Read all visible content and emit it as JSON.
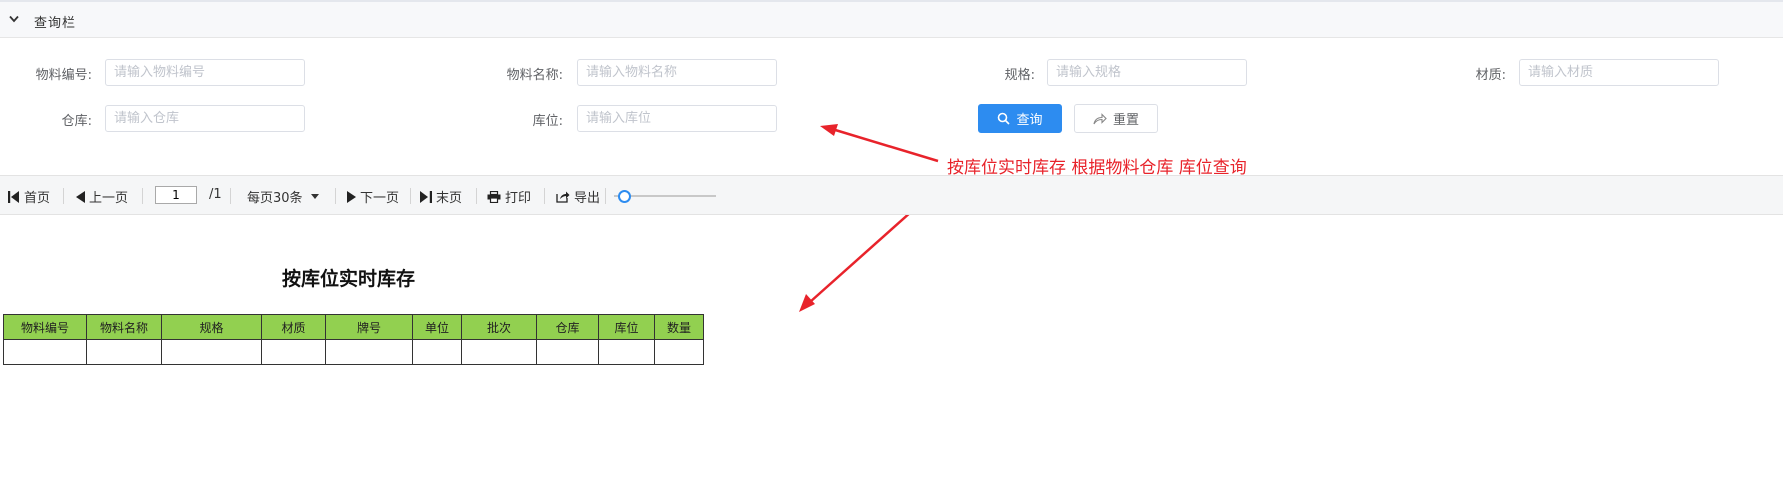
{
  "query_bar": {
    "title": "查询栏",
    "fields": [
      {
        "label": "物料编号:",
        "placeholder": "请输入物料编号"
      },
      {
        "label": "物料名称:",
        "placeholder": "请输入物料名称"
      },
      {
        "label": "规格:",
        "placeholder": "请输入规格"
      },
      {
        "label": "材质:",
        "placeholder": "请输入材质"
      },
      {
        "label": "仓库:",
        "placeholder": "请输入仓库"
      },
      {
        "label": "库位:",
        "placeholder": "请输入库位"
      }
    ],
    "query_label": "查询",
    "reset_label": "重置",
    "accent_color": "#2d8cf0"
  },
  "annotation": {
    "text": "按库位实时库存  根据物料仓库 库位查询",
    "color": "#e8232b"
  },
  "toolbar": {
    "first": "首页",
    "prev": "上一页",
    "page_value": "1",
    "total_pages": "/1",
    "page_size": "每页30条",
    "next": "下一页",
    "last": "末页",
    "print": "打印",
    "export": "导出",
    "zoom_fraction": 0.1
  },
  "report": {
    "title": "按库位实时库存",
    "header_color": "#92d050",
    "columns": [
      "物料编号",
      "物料名称",
      "规格",
      "材质",
      "牌号",
      "单位",
      "批次",
      "仓库",
      "库位",
      "数量"
    ],
    "rows": [
      [
        "",
        "",
        "",
        "",
        "",
        "",
        "",
        "",
        "",
        ""
      ]
    ]
  },
  "icons": [
    "chevron-down-icon",
    "search-icon",
    "share-icon",
    "first-page-icon",
    "prev-page-icon",
    "next-page-icon",
    "last-page-icon",
    "print-icon",
    "export-icon"
  ]
}
